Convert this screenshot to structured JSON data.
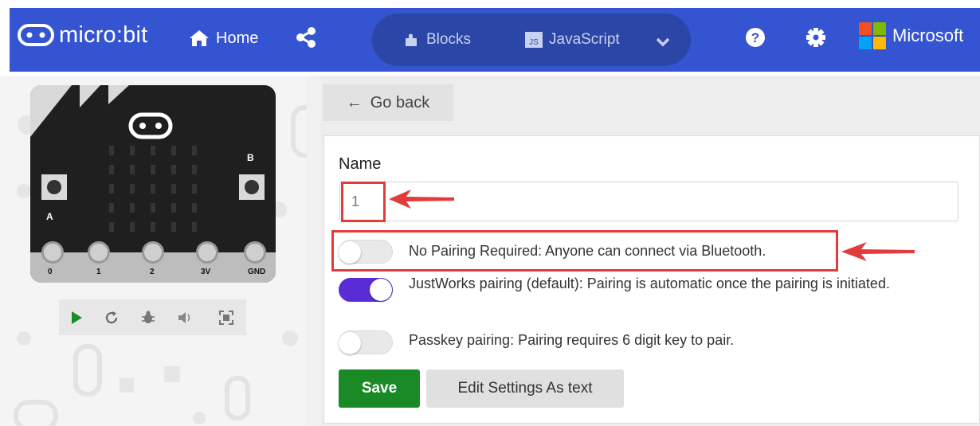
{
  "app": {
    "logo_text": "micro:bit",
    "brand": "Microsoft"
  },
  "nav": {
    "home_label": "Home"
  },
  "editor_toggle": {
    "blocks_label": "Blocks",
    "javascript_label": "JavaScript"
  },
  "simulator": {
    "pins": [
      "0",
      "1",
      "2",
      "3V",
      "GND"
    ],
    "button_a": "A",
    "button_b": "B"
  },
  "back_button": {
    "label": "Go back"
  },
  "form": {
    "name_label": "Name",
    "name_value": "1",
    "options": [
      {
        "label": "No Pairing Required: Anyone can connect via Bluetooth.",
        "enabled": false
      },
      {
        "label": "JustWorks pairing (default): Pairing is automatic once the pairing is initiated.",
        "enabled": true
      },
      {
        "label": "Passkey pairing: Pairing requires 6 digit key to pair.",
        "enabled": false
      }
    ],
    "save_label": "Save",
    "edit_text_label": "Edit Settings As text"
  },
  "colors": {
    "topbar": "#3454d1",
    "toggle_on": "#5a2cd6",
    "save": "#198a26",
    "annotation": "#e23b3b"
  }
}
